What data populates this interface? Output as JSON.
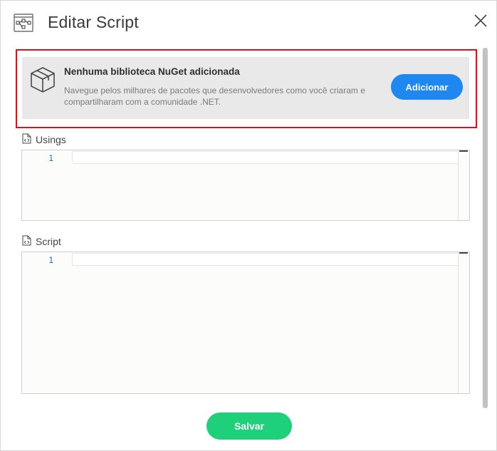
{
  "dialog": {
    "title": "Editar Script",
    "header_icon": "flow-diagram-icon",
    "close_icon": "close-icon"
  },
  "nuget": {
    "title": "Nenhuma biblioteca NuGet adicionada",
    "description": "Navegue pelos milhares de pacotes que desenvolvedores como você criaram e compartilharam com a comunidade .NET.",
    "add_label": "Adicionar",
    "icon": "package-box-icon"
  },
  "usings": {
    "label": "Usings",
    "icon": "code-file-icon",
    "line_numbers": [
      "1"
    ]
  },
  "script": {
    "label": "Script",
    "icon": "code-file-icon",
    "line_numbers": [
      "1"
    ]
  },
  "footer": {
    "save_label": "Salvar"
  },
  "colors": {
    "highlight_border": "#e0101a",
    "add_button": "#1e88f0",
    "save_button": "#1fd07a",
    "line_number": "#2a74b6"
  }
}
